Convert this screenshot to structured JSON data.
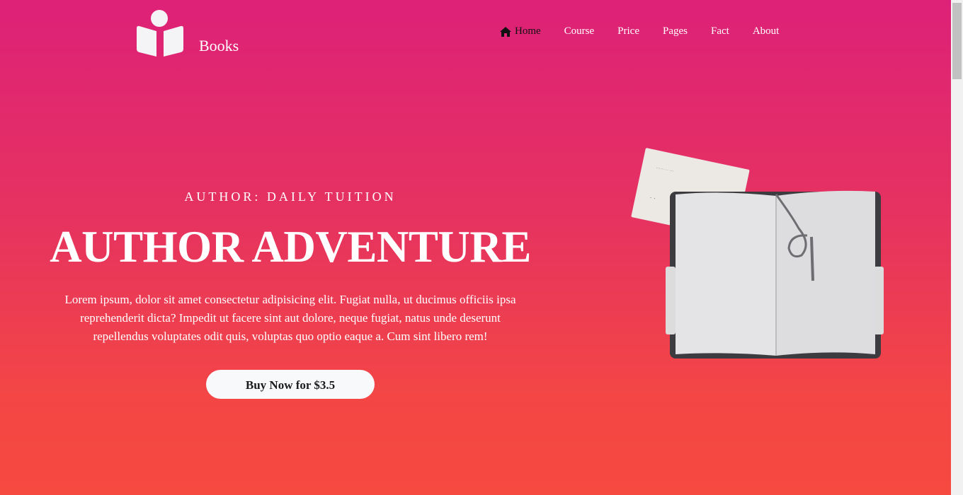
{
  "brand": {
    "name": "Books",
    "logo_icon": "book-reader-icon"
  },
  "nav": {
    "items": [
      {
        "label": "Home",
        "icon": "home-icon",
        "active": true
      },
      {
        "label": "Course"
      },
      {
        "label": "Price"
      },
      {
        "label": "Pages"
      },
      {
        "label": "Fact"
      },
      {
        "label": "About"
      }
    ]
  },
  "hero": {
    "kicker": "AUTHOR: DAILY TUITION",
    "title": "AUTHOR ADVENTURE",
    "description": "Lorem ipsum, dolor sit amet consectetur adipisicing elit. Fugiat nulla, ut ducimus officiis ipsa reprehenderit dicta? Impedit ut facere sint aut dolore, neque fugiat, natus unde deserunt repellendus voluptates odit quis, voluptas quo optio eaque a. Cum sint libero rem!",
    "button_label": "Buy Now for $3.5",
    "image": "open-notebook-image"
  },
  "colors": {
    "gradient_top": "#dd2178",
    "gradient_bottom": "#f6493f",
    "button_bg": "#f8f9fa",
    "text": "#ffffff"
  }
}
